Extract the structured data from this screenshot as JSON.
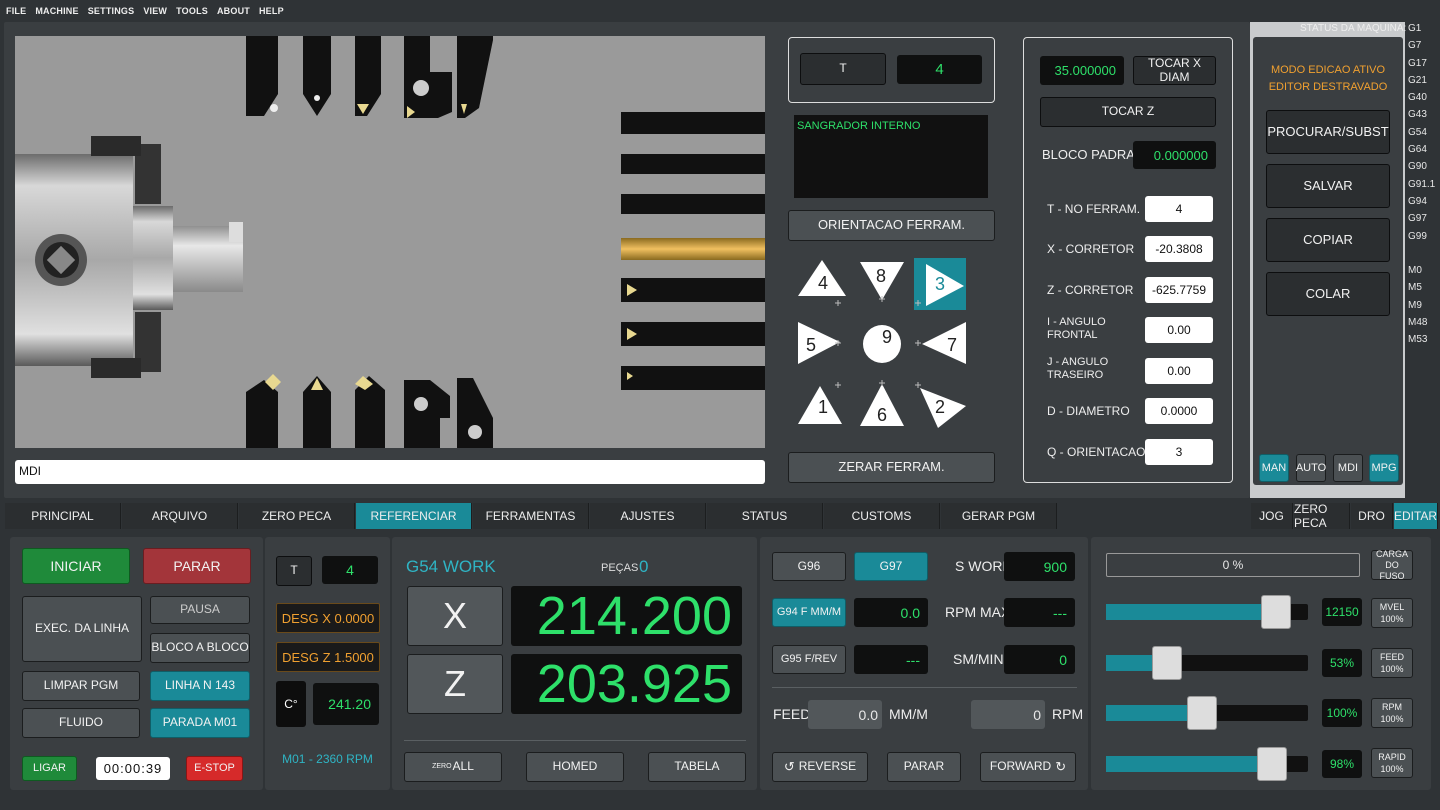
{
  "menu": [
    "FILE",
    "MACHINE",
    "SETTINGS",
    "VIEW",
    "TOOLS",
    "ABOUT",
    "HELP"
  ],
  "mdi_input": "MDI",
  "tool_panel": {
    "t_label": "T",
    "t_value": "4",
    "tool_name": "SANGRADOR INTERNO",
    "orient_button": "ORIENTACAO FERRAM.",
    "orientations": [
      "4",
      "8",
      "3",
      "5",
      "9",
      "7",
      "1",
      "6",
      "2"
    ],
    "orient_selected": "3",
    "zero_button": "ZERAR FERRAM."
  },
  "offsets": {
    "x_value": "35.000000",
    "tocar_x": "TOCAR X DIAM",
    "tocar_z": "TOCAR Z",
    "bloco_label": "BLOCO PADRAO",
    "bloco_value": "0.000000",
    "rows": [
      {
        "label": "T - NO FERRAM.",
        "value": "4"
      },
      {
        "label": "X - CORRETOR",
        "value": "-20.3808"
      },
      {
        "label": "Z - CORRETOR",
        "value": "-625.7759"
      },
      {
        "label": "I - ANGULO FRONTAL",
        "value": "0.00"
      },
      {
        "label": "J - ANGULO TRASEIRO",
        "value": "0.00"
      },
      {
        "label": "D - DIAMETRO",
        "value": "0.0000"
      },
      {
        "label": "Q - ORIENTACAO",
        "value": "3"
      }
    ]
  },
  "editor": {
    "mode1": "MODO EDICAO ATIVO",
    "mode2": "EDITOR DESTRAVADO",
    "buttons": [
      "PROCURAR/SUBST",
      "SALVAR",
      "COPIAR",
      "COLAR"
    ],
    "modes": [
      "MAN",
      "AUTO",
      "MDI",
      "MPG"
    ]
  },
  "status": {
    "title": "STATUS DA MAQUINA:",
    "codes": [
      "G1",
      "G7",
      "G17",
      "G21",
      "G40",
      "G43",
      "G54",
      "G64",
      "G90",
      "G91.1",
      "G94",
      "G97",
      "G99",
      "",
      "M0",
      "M5",
      "M9",
      "M48",
      "M53"
    ]
  },
  "tabs": [
    "PRINCIPAL",
    "ARQUIVO",
    "ZERO PECA",
    "REFERENCIAR",
    "FERRAMENTAS",
    "AJUSTES",
    "STATUS",
    "CUSTOMS",
    "GERAR PGM"
  ],
  "active_tab": "REFERENCIAR",
  "right_tabs": [
    "JOG",
    "ZERO PECA",
    "DRO",
    "EDITAR"
  ],
  "control": {
    "iniciar": "INICIAR",
    "parar": "PARAR",
    "pausa": "PAUSA",
    "exec": "EXEC. DA LINHA",
    "bloco": "BLOCO A BLOCO",
    "limpar": "LIMPAR PGM",
    "linha": "LINHA N 143",
    "fluido": "FLUIDO",
    "parada": "PARADA M01",
    "ligar": "LIGAR",
    "timer": "00:00:39",
    "estop": "E-STOP"
  },
  "tool_info": {
    "t_label": "T",
    "t_value": "4",
    "desg_x": "DESG X 0.0000",
    "desg_z": "DESG Z 1.5000",
    "temp_label": "C°",
    "temp_value": "241.20",
    "spindle_info": "M01 - 2360 RPM"
  },
  "dro": {
    "work": "G54 WORK",
    "pecas_label": "PEÇAS",
    "pecas_value": "0",
    "x_label": "X",
    "x_value": "214.200",
    "z_label": "Z",
    "z_value": "203.925",
    "zero_small": "ZERO",
    "zero_all": "ALL",
    "homed": "HOMED",
    "tabela": "TABELA"
  },
  "spindle": {
    "g96": "G96",
    "g97": "G97",
    "g94": "G94 F MM/M",
    "g94_value": "0.0",
    "g95": "G95 F/REV",
    "g95_value": "---",
    "sword_label": "S WORD",
    "sword_value": "900",
    "rpmmax_label": "RPM MAX",
    "rpmmax_value": "---",
    "smmin_label": "SM/MIN",
    "smmin_value": "0",
    "feed_label": "FEED",
    "feed_value": "0.0",
    "feed_unit": "MM/M",
    "rpm_value": "0",
    "rpm_unit": "RPM",
    "reverse": "REVERSE",
    "parar": "PARAR",
    "forward": "FORWARD"
  },
  "overrides": {
    "progress": "0 %",
    "carga": "CARGA DO FUSO",
    "rows": [
      {
        "value": "12150",
        "label": "MVEL",
        "pct": "100%",
        "level": 0.9
      },
      {
        "value": "53%",
        "label": "FEED",
        "pct": "100%",
        "level": 0.27
      },
      {
        "value": "100%",
        "label": "RPM",
        "pct": "100%",
        "level": 0.47
      },
      {
        "value": "98%",
        "label": "RAPID",
        "pct": "100%",
        "level": 0.88
      }
    ]
  },
  "colors": {
    "accent": "#1a8a98",
    "dro_green": "#2ee06a",
    "orange": "#f0a030"
  }
}
